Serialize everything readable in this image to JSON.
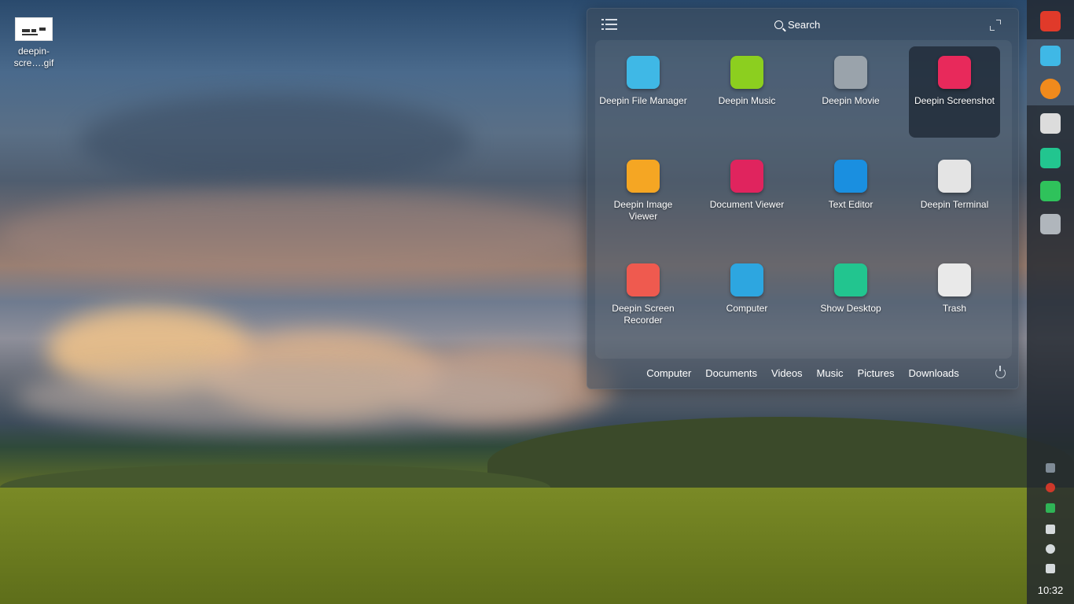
{
  "desktop": {
    "file_label": "deepin-\nscre….gif"
  },
  "launcher": {
    "search_label": "Search",
    "apps": [
      {
        "label": "Deepin File Manager",
        "icon": "file-manager-icon",
        "color": "#3fb8e6"
      },
      {
        "label": "Deepin Music",
        "icon": "music-icon",
        "color": "#8ccf1f"
      },
      {
        "label": "Deepin Movie",
        "icon": "movie-icon",
        "color": "#9aa3ab"
      },
      {
        "label": "Deepin Screenshot",
        "icon": "screenshot-icon",
        "color": "#e8295b"
      },
      {
        "label": "Deepin Image Viewer",
        "icon": "image-viewer-icon",
        "color": "#f5a623"
      },
      {
        "label": "Document Viewer",
        "icon": "document-viewer-icon",
        "color": "#e0245e"
      },
      {
        "label": "Text Editor",
        "icon": "text-editor-icon",
        "color": "#1a8fe0"
      },
      {
        "label": "Deepin Terminal",
        "icon": "terminal-icon",
        "color": "#e4e4e4"
      },
      {
        "label": "Deepin Screen Recorder",
        "icon": "screen-recorder-icon",
        "color": "#ef5a4f"
      },
      {
        "label": "Computer",
        "icon": "computer-icon",
        "color": "#2da6e0"
      },
      {
        "label": "Show Desktop",
        "icon": "show-desktop-icon",
        "color": "#22c58f"
      },
      {
        "label": "Trash",
        "icon": "trash-icon",
        "color": "#e9e9e9"
      }
    ],
    "bottom_links": [
      "Computer",
      "Documents",
      "Videos",
      "Music",
      "Pictures",
      "Downloads"
    ]
  },
  "dock": {
    "apps": [
      {
        "name": "launcher-icon",
        "color": "#e03a2a"
      },
      {
        "name": "file-manager-icon",
        "color": "#3fb8e6"
      },
      {
        "name": "firefox-icon",
        "color": "#f08a1c"
      },
      {
        "name": "terminal-icon",
        "color": "#dcdcdc"
      },
      {
        "name": "show-desktop-icon",
        "color": "#22c58f"
      },
      {
        "name": "system-monitor-icon",
        "color": "#2fc25b"
      },
      {
        "name": "settings-icon",
        "color": "#b0b6bc"
      }
    ],
    "tray": [
      "keyboard-icon",
      "bug-icon",
      "calendar-icon",
      "wifi-icon",
      "power-icon",
      "volume-icon"
    ],
    "clock": "10:32"
  }
}
